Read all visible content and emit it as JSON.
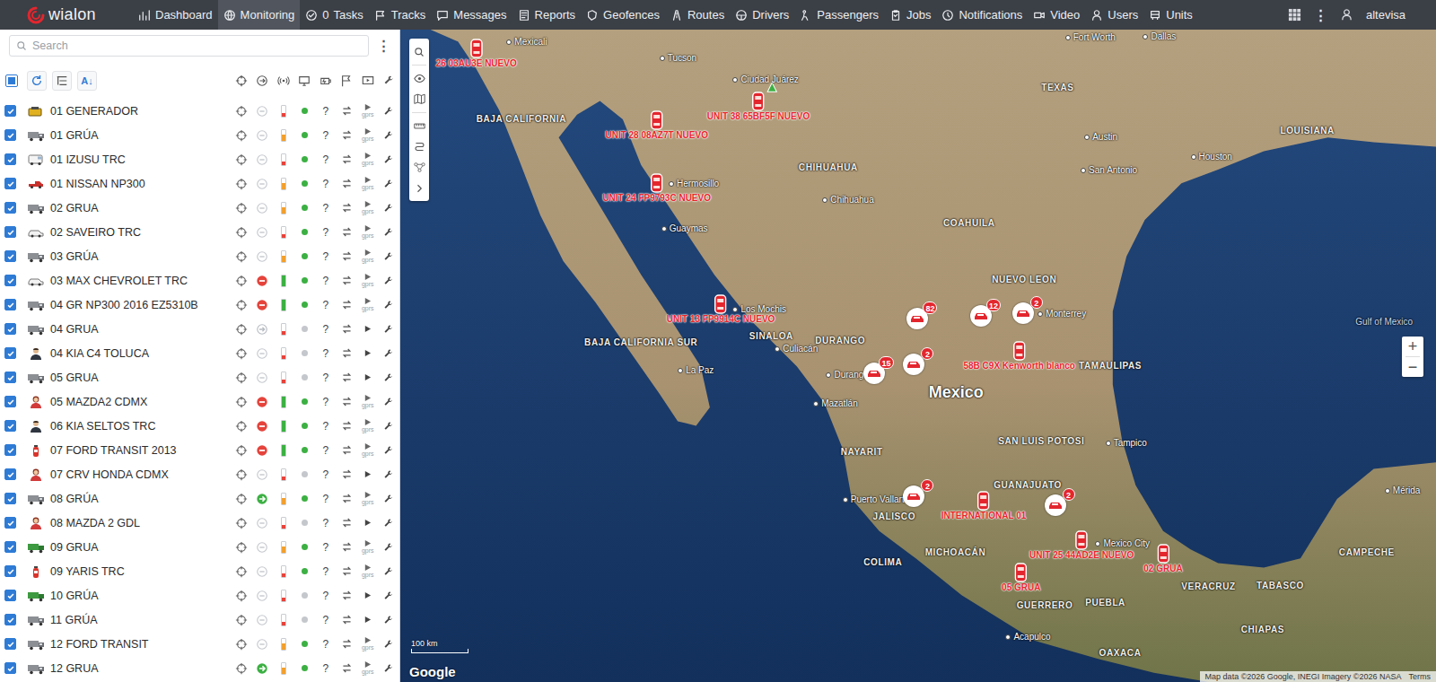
{
  "app": {
    "logo": "wialon",
    "user": "altevisa",
    "more": "⋮"
  },
  "nav": [
    {
      "label": "Dashboard",
      "kind": "dashboard",
      "selected": false
    },
    {
      "label": "Monitoring",
      "kind": "monitoring",
      "selected": true
    },
    {
      "label": "Tasks",
      "count": "0",
      "kind": "tasks",
      "selected": false
    },
    {
      "label": "Tracks",
      "kind": "tracks",
      "selected": false
    },
    {
      "label": "Messages",
      "kind": "messages",
      "selected": false
    },
    {
      "label": "Reports",
      "kind": "reports",
      "selected": false
    },
    {
      "label": "Geofences",
      "kind": "geofences",
      "selected": false
    },
    {
      "label": "Routes",
      "kind": "routes",
      "selected": false
    },
    {
      "label": "Drivers",
      "kind": "drivers",
      "selected": false
    },
    {
      "label": "Passengers",
      "kind": "passengers",
      "selected": false
    },
    {
      "label": "Jobs",
      "kind": "jobs",
      "selected": false
    },
    {
      "label": "Notifications",
      "kind": "notifications",
      "selected": false
    },
    {
      "label": "Video",
      "kind": "video",
      "selected": false
    },
    {
      "label": "Users",
      "kind": "users",
      "selected": false
    },
    {
      "label": "Units",
      "kind": "units",
      "selected": false
    }
  ],
  "search": {
    "placeholder": "Search",
    "menu": "⋮"
  },
  "list_toolbar": {
    "select_all": true,
    "sort": "A↓"
  },
  "gprs_label": "gprs",
  "units": [
    {
      "name": "01 GENERADOR",
      "kind": "generator",
      "checked": true,
      "motion": "stopped",
      "level": 0.3,
      "color": "#e5433b",
      "online": true,
      "sensor": "?",
      "gprs": true
    },
    {
      "name": "01 GRÚA",
      "kind": "truck",
      "checked": true,
      "motion": "stopped",
      "level": 0.55,
      "color": "#f0a030",
      "online": true,
      "sensor": "?",
      "gprs": true
    },
    {
      "name": "01 IZUSU TRC",
      "kind": "van",
      "checked": true,
      "motion": "stopped",
      "level": 0.3,
      "color": "#e5433b",
      "online": true,
      "sensor": "?",
      "gprs": true
    },
    {
      "name": "01 NISSAN NP300",
      "kind": "pickup",
      "checked": true,
      "motion": "stopped",
      "level": 0.55,
      "color": "#f0a030",
      "online": true,
      "sensor": "?",
      "gprs": true
    },
    {
      "name": "02 GRUA",
      "kind": "truck",
      "checked": true,
      "motion": "stopped",
      "level": 0.55,
      "color": "#f0a030",
      "online": true,
      "sensor": "?",
      "gprs": true
    },
    {
      "name": "02 SAVEIRO TRC",
      "kind": "car",
      "checked": true,
      "motion": "stopped",
      "level": 0.3,
      "color": "#e5433b",
      "online": true,
      "sensor": "?",
      "gprs": true
    },
    {
      "name": "03 GRÚA",
      "kind": "truck",
      "checked": true,
      "motion": "stopped",
      "level": 0.55,
      "color": "#f0a030",
      "online": true,
      "sensor": "?",
      "gprs": true
    },
    {
      "name": "03 MAX CHEVROLET TRC",
      "kind": "car",
      "checked": true,
      "motion": "blocked",
      "level": 1,
      "color": "#3cb043",
      "online": true,
      "sensor": "?",
      "gprs": true
    },
    {
      "name": "04 GR NP300 2016 EZ5310B",
      "kind": "truck",
      "checked": true,
      "motion": "blocked",
      "level": 1,
      "color": "#3cb043",
      "online": true,
      "sensor": "?",
      "gprs": true
    },
    {
      "name": "04 GRUA",
      "kind": "truck",
      "checked": true,
      "motion": "idle",
      "level": 0.3,
      "color": "#e5433b",
      "online": false,
      "sensor": "?",
      "gprs": false
    },
    {
      "name": "04 KIA C4 TOLUCA",
      "kind": "man",
      "checked": true,
      "motion": "stopped",
      "level": 0.3,
      "color": "#e5433b",
      "online": false,
      "sensor": "?",
      "gprs": false
    },
    {
      "name": "05 GRUA",
      "kind": "truck",
      "checked": true,
      "motion": "stopped",
      "level": 0.3,
      "color": "#e5433b",
      "online": false,
      "sensor": "?",
      "gprs": false
    },
    {
      "name": "05 MAZDA2 CDMX",
      "kind": "woman",
      "checked": true,
      "motion": "blocked",
      "level": 1,
      "color": "#3cb043",
      "online": true,
      "sensor": "?",
      "gprs": true
    },
    {
      "name": "06 KIA SELTOS TRC",
      "kind": "man",
      "checked": true,
      "motion": "blocked",
      "level": 1,
      "color": "#3cb043",
      "online": true,
      "sensor": "?",
      "gprs": true
    },
    {
      "name": "07 FORD TRANSIT 2013",
      "kind": "extinguisher",
      "checked": true,
      "motion": "blocked",
      "level": 1,
      "color": "#3cb043",
      "online": true,
      "sensor": "?",
      "gprs": true
    },
    {
      "name": "07 CRV HONDA CDMX",
      "kind": "woman",
      "checked": true,
      "motion": "stopped",
      "level": 0.3,
      "color": "#e5433b",
      "online": false,
      "sensor": "?",
      "gprs": false
    },
    {
      "name": "08 GRÚA",
      "kind": "truck",
      "checked": true,
      "motion": "moving",
      "level": 0.55,
      "color": "#f0a030",
      "online": true,
      "sensor": "?",
      "gprs": true
    },
    {
      "name": "08 MAZDA 2 GDL",
      "kind": "woman",
      "checked": true,
      "motion": "stopped",
      "level": 0.3,
      "color": "#e5433b",
      "online": false,
      "sensor": "?",
      "gprs": false
    },
    {
      "name": "09 GRUA",
      "kind": "greentruck",
      "checked": true,
      "motion": "stopped",
      "level": 0.55,
      "color": "#f0a030",
      "online": true,
      "sensor": "?",
      "gprs": true
    },
    {
      "name": "09 YARIS TRC",
      "kind": "extinguisher",
      "checked": true,
      "motion": "stopped",
      "level": 0.3,
      "color": "#e5433b",
      "online": true,
      "sensor": "?",
      "gprs": true
    },
    {
      "name": "10 GRÚA",
      "kind": "greentruck",
      "checked": true,
      "motion": "stopped",
      "level": 0.3,
      "color": "#e5433b",
      "online": false,
      "sensor": "?",
      "gprs": false
    },
    {
      "name": "11 GRÚA",
      "kind": "truck",
      "checked": true,
      "motion": "stopped",
      "level": 0.3,
      "color": "#e5433b",
      "online": false,
      "sensor": "?",
      "gprs": false
    },
    {
      "name": "12 FORD TRANSIT",
      "kind": "truck",
      "checked": true,
      "motion": "stopped",
      "level": 0.55,
      "color": "#f0a030",
      "online": true,
      "sensor": "?",
      "gprs": true
    },
    {
      "name": "12 GRUA",
      "kind": "truck",
      "checked": true,
      "motion": "moving",
      "level": 0.55,
      "color": "#f0a030",
      "online": true,
      "sensor": "?",
      "gprs": true
    }
  ],
  "map": {
    "labels": [
      {
        "text": "TEXAS",
        "kind": "region"
      },
      {
        "text": "LOUISIANA",
        "kind": "region"
      },
      {
        "text": "CHIHUAHUA",
        "kind": "region"
      },
      {
        "text": "COAHUILA",
        "kind": "region"
      },
      {
        "text": "NUEVO LEON",
        "kind": "region"
      },
      {
        "text": "TAMAULIPAS",
        "kind": "region"
      },
      {
        "text": "BAJA CALIFORNIA",
        "kind": "region"
      },
      {
        "text": "BAJA CALIFORNIA SUR",
        "kind": "region"
      },
      {
        "text": "SINALOA",
        "kind": "region"
      },
      {
        "text": "DURANGO",
        "kind": "region"
      },
      {
        "text": "Mexico",
        "kind": "country"
      },
      {
        "text": "SAN LUIS POTOSI",
        "kind": "region"
      },
      {
        "text": "NAYARIT",
        "kind": "region"
      },
      {
        "text": "JALISCO",
        "kind": "region"
      },
      {
        "text": "GUANAJUATO",
        "kind": "region"
      },
      {
        "text": "MICHOACÁN",
        "kind": "region"
      },
      {
        "text": "COLIMA",
        "kind": "region"
      },
      {
        "text": "GUERRERO",
        "kind": "region"
      },
      {
        "text": "PUEBLA",
        "kind": "region"
      },
      {
        "text": "VERACRUZ",
        "kind": "region"
      },
      {
        "text": "OAXACA",
        "kind": "region"
      },
      {
        "text": "CHIAPAS",
        "kind": "region"
      },
      {
        "text": "TABASCO",
        "kind": "region"
      },
      {
        "text": "CAMPECHE",
        "kind": "region"
      },
      {
        "text": "Gulf of Mexico",
        "kind": "water"
      },
      {
        "text": "Dallas",
        "kind": "city"
      },
      {
        "text": "Fort Worth",
        "kind": "city"
      },
      {
        "text": "Austin",
        "kind": "city"
      },
      {
        "text": "San Antonio",
        "kind": "city"
      },
      {
        "text": "Houston",
        "kind": "city"
      },
      {
        "text": "Monterrey",
        "kind": "city"
      },
      {
        "text": "Chihuahua",
        "kind": "city"
      },
      {
        "text": "Hermosillo",
        "kind": "city"
      },
      {
        "text": "Tucson",
        "kind": "city"
      },
      {
        "text": "Ciudad Juárez",
        "kind": "city"
      },
      {
        "text": "Culiacán",
        "kind": "city"
      },
      {
        "text": "Mazatlán",
        "kind": "city"
      },
      {
        "text": "La Paz",
        "kind": "city"
      },
      {
        "text": "Los Mochis",
        "kind": "city"
      },
      {
        "text": "Guaymas",
        "kind": "city"
      },
      {
        "text": "Tampico",
        "kind": "city"
      },
      {
        "text": "Acapulco",
        "kind": "city"
      },
      {
        "text": "Mérida",
        "kind": "city"
      },
      {
        "text": "Puerto Vallarta",
        "kind": "city"
      },
      {
        "text": "Mexico City",
        "kind": "city"
      },
      {
        "text": "Durango",
        "kind": "city"
      },
      {
        "text": "Mexicali",
        "kind": "city"
      }
    ],
    "units": [
      {
        "label": "26 03AU3E NUEVO"
      },
      {
        "label": "UNIT 38 65BF5F NUEVO"
      },
      {
        "label": "UNIT 28 08AZ7T NUEVO"
      },
      {
        "label": "UNIT 24 FP9793C NUEVO"
      },
      {
        "label": "UNIT 13 FP9914C NUEVO"
      },
      {
        "label": "58B C9X Kenworth blanco"
      },
      {
        "label": "INTERNATIONAL 01"
      },
      {
        "label": "UNIT 25 44AD2E NUEVO"
      },
      {
        "label": "05 GRUA"
      },
      {
        "label": "02 GRUA"
      }
    ],
    "clusters": [
      {
        "count": "82"
      },
      {
        "count": "12"
      },
      {
        "count": "2"
      },
      {
        "count": "15"
      },
      {
        "count": "2"
      },
      {
        "count": "2"
      },
      {
        "count": "2"
      }
    ],
    "zoom_in": "+",
    "zoom_out": "−",
    "scale": "100 km",
    "provider": "Google",
    "attribution": "Map data ©2026 Google, INEGI Imagery ©2026 NASA",
    "terms": "Terms"
  }
}
